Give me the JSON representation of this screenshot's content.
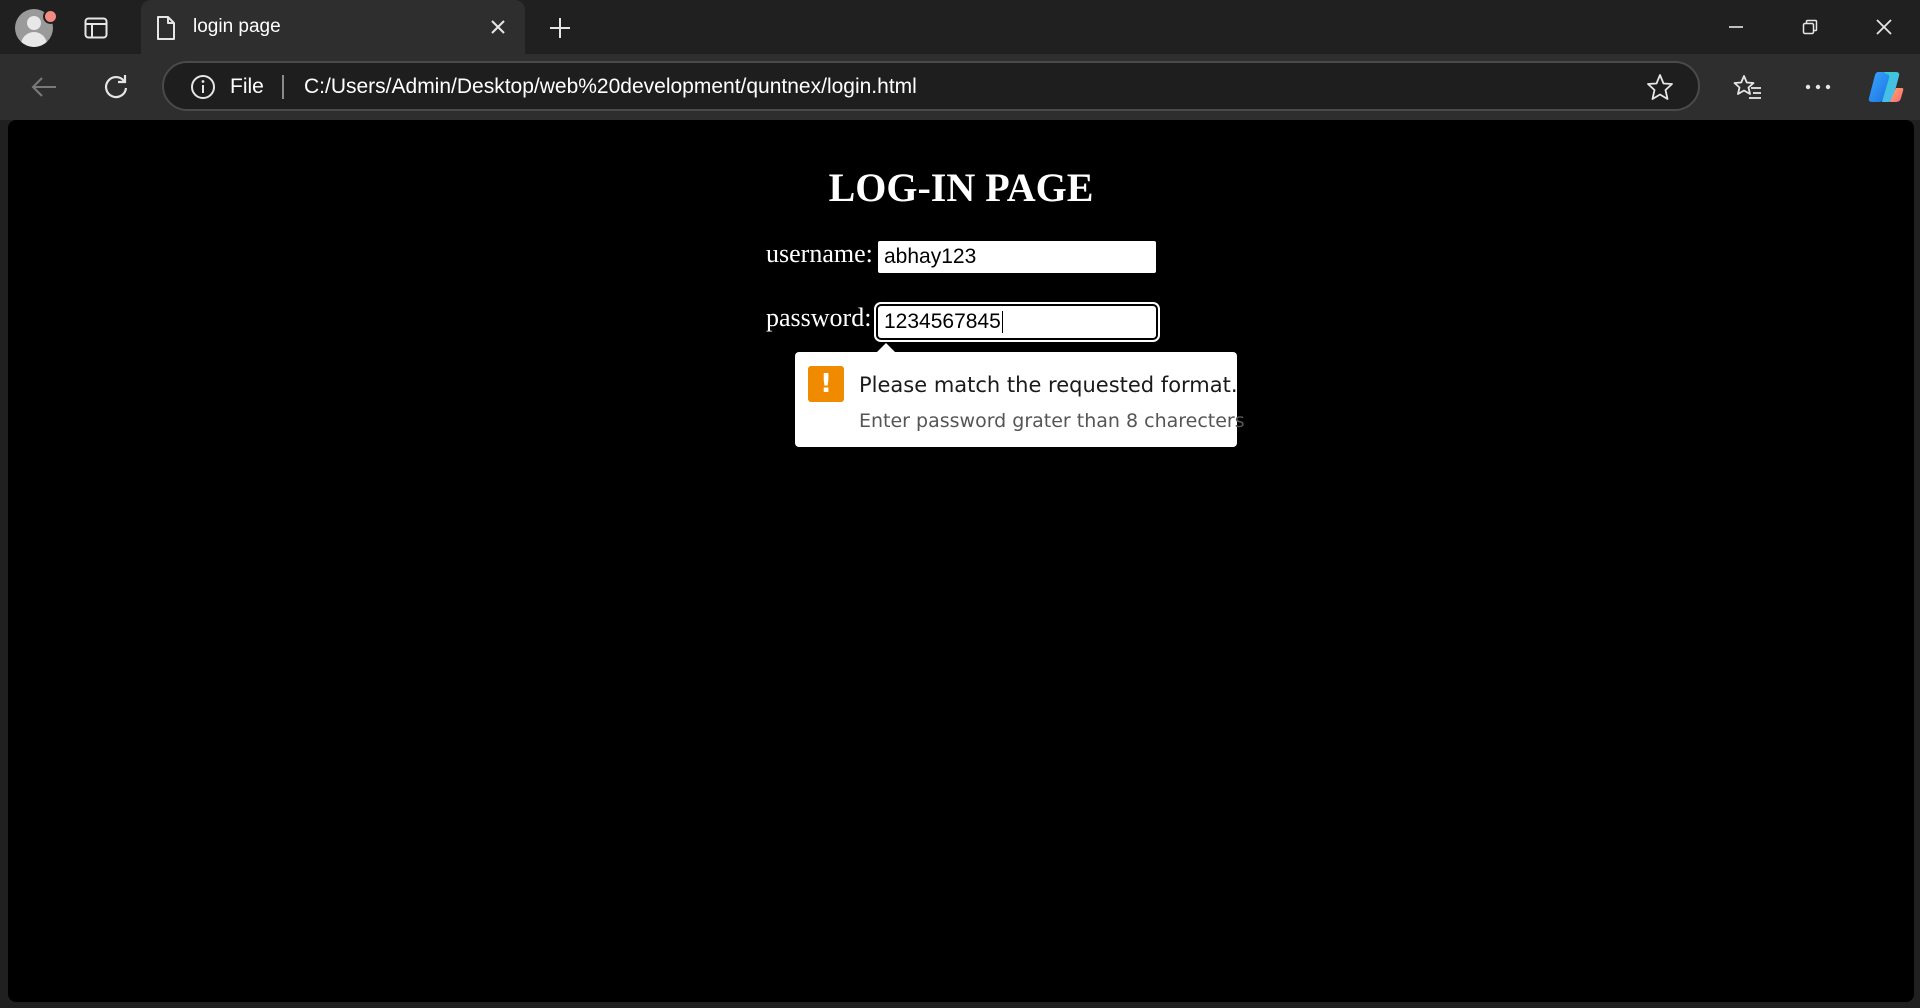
{
  "browser": {
    "tab": {
      "title": "login page"
    },
    "address_bar": {
      "scheme_label": "File",
      "url": "C:/Users/Admin/Desktop/web%20development/quntnex/login.html"
    }
  },
  "page": {
    "heading": "LOG-IN PAGE",
    "username": {
      "label": "username:",
      "value": "abhay123"
    },
    "password": {
      "label": "password:",
      "value": "1234567845"
    }
  },
  "validation": {
    "message": "Please match the requested format.",
    "hint": "Enter password grater than 8 charecters",
    "icon": "!"
  },
  "colors": {
    "page_background": "#000000",
    "chrome_background": "#202020",
    "warning": "#f08a00"
  },
  "icons": [
    "profile-avatar",
    "tab-actions-icon",
    "page-icon",
    "close-icon",
    "plus-icon",
    "minimize-icon",
    "restore-icon",
    "back-arrow-icon",
    "refresh-icon",
    "info-icon",
    "star-icon",
    "favorites-icon",
    "more-icon",
    "copilot-icon"
  ]
}
